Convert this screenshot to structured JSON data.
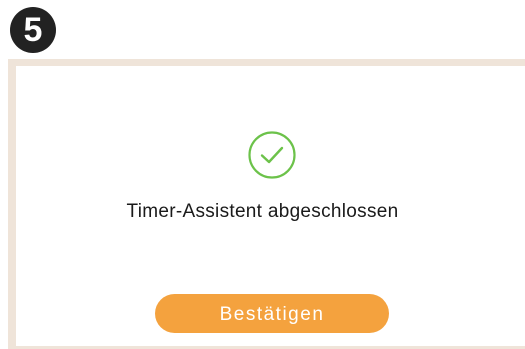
{
  "step": {
    "number": "5"
  },
  "dialog": {
    "icon": "check-circle-icon",
    "message": "Timer-Assistent abgeschlossen",
    "confirm_label": "Bestätigen"
  },
  "colors": {
    "accent": "#f4a23e",
    "success": "#6cc24a",
    "frame": "#efe4d9",
    "badge": "#222222"
  }
}
